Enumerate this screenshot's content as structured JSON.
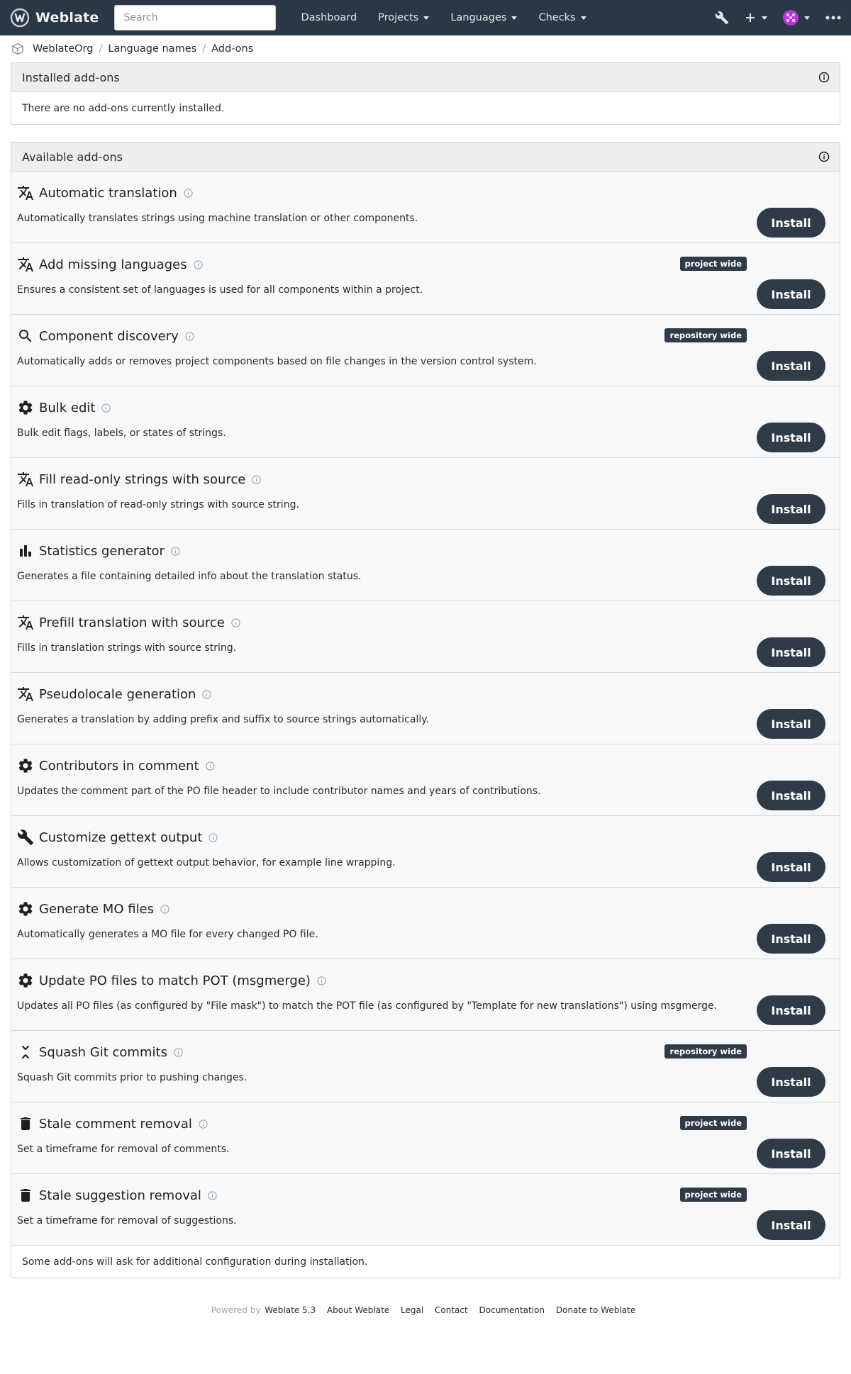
{
  "navbar": {
    "brand": "Weblate",
    "search_placeholder": "Search",
    "links": [
      "Dashboard",
      "Projects",
      "Languages",
      "Checks"
    ]
  },
  "breadcrumb": [
    "WeblateOrg",
    "Language names",
    "Add-ons"
  ],
  "installed": {
    "heading": "Installed add-ons",
    "empty_text": "There are no add-ons currently installed."
  },
  "available": {
    "heading": "Available add-ons",
    "install_label": "Install",
    "footer_note": "Some add-ons will ask for additional configuration during installation.",
    "addons": [
      {
        "icon": "translate-icon",
        "title": "Automatic translation",
        "desc": "Automatically translates strings using machine translation or other components.",
        "badge": ""
      },
      {
        "icon": "translate-icon",
        "title": "Add missing languages",
        "desc": "Ensures a consistent set of languages is used for all components within a project.",
        "badge": "project wide"
      },
      {
        "icon": "search-icon",
        "title": "Component discovery",
        "desc": "Automatically adds or removes project components based on file changes in the version control system.",
        "badge": "repository wide"
      },
      {
        "icon": "gear-icon",
        "title": "Bulk edit",
        "desc": "Bulk edit flags, labels, or states of strings.",
        "badge": ""
      },
      {
        "icon": "translate-icon",
        "title": "Fill read-only strings with source",
        "desc": "Fills in translation of read-only strings with source string.",
        "badge": ""
      },
      {
        "icon": "chart-icon",
        "title": "Statistics generator",
        "desc": "Generates a file containing detailed info about the translation status.",
        "badge": ""
      },
      {
        "icon": "translate-icon",
        "title": "Prefill translation with source",
        "desc": "Fills in translation strings with source string.",
        "badge": ""
      },
      {
        "icon": "translate-icon",
        "title": "Pseudolocale generation",
        "desc": "Generates a translation by adding prefix and suffix to source strings automatically.",
        "badge": ""
      },
      {
        "icon": "gear-icon",
        "title": "Contributors in comment",
        "desc": "Updates the comment part of the PO file header to include contributor names and years of contributions.",
        "badge": ""
      },
      {
        "icon": "wrench-icon",
        "title": "Customize gettext output",
        "desc": "Allows customization of gettext output behavior, for example line wrapping.",
        "badge": ""
      },
      {
        "icon": "gear-icon",
        "title": "Generate MO files",
        "desc": "Automatically generates a MO file for every changed PO file.",
        "badge": ""
      },
      {
        "icon": "gear-icon",
        "title": "Update PO files to match POT (msgmerge)",
        "desc": "Updates all PO files (as configured by \"File mask\") to match the POT file (as configured by \"Template for new translations\") using msgmerge.",
        "badge": ""
      },
      {
        "icon": "squash-icon",
        "title": "Squash Git commits",
        "desc": "Squash Git commits prior to pushing changes.",
        "badge": "repository wide"
      },
      {
        "icon": "trash-icon",
        "title": "Stale comment removal",
        "desc": "Set a timeframe for removal of comments.",
        "badge": "project wide"
      },
      {
        "icon": "trash-icon",
        "title": "Stale suggestion removal",
        "desc": "Set a timeframe for removal of suggestions.",
        "badge": "project wide"
      }
    ]
  },
  "footer": {
    "powered_by": "Powered by",
    "links": [
      "Weblate 5.3",
      "About Weblate",
      "Legal",
      "Contact",
      "Documentation",
      "Donate to Weblate"
    ]
  }
}
